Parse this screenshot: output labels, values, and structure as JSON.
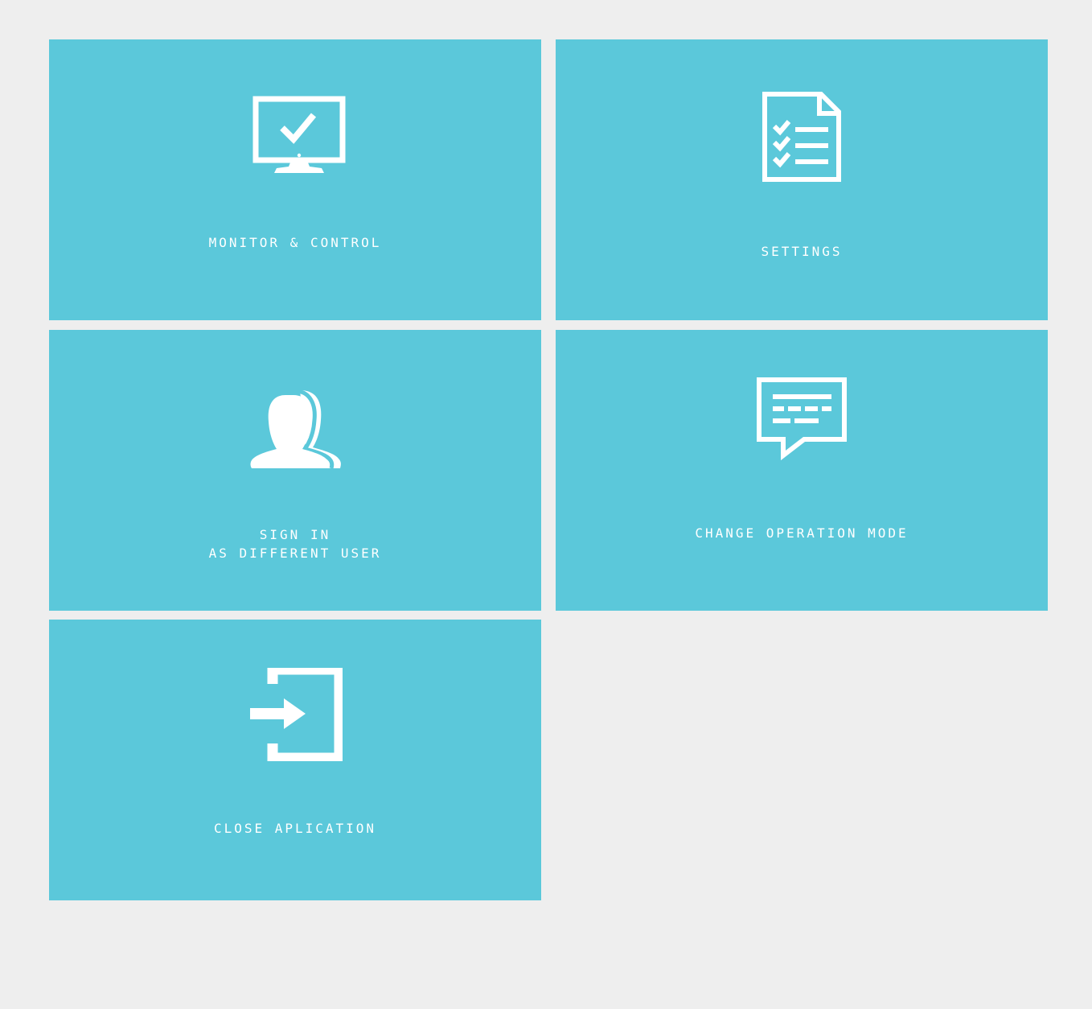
{
  "theme": {
    "background": "#eeeeee",
    "tile_color": "#5bc8da",
    "text_color": "#ffffff"
  },
  "tiles": {
    "monitor": {
      "label": "MONITOR & CONTROL",
      "icon": "monitor-check-icon"
    },
    "settings": {
      "label": "SETTINGS",
      "icon": "checklist-document-icon"
    },
    "signin": {
      "label_line1": "SIGN IN",
      "label_line2": "AS DIFFERENT USER",
      "icon": "users-icon"
    },
    "mode": {
      "label": "CHANGE OPERATION MODE",
      "icon": "speech-bubble-icon"
    },
    "close": {
      "label": "CLOSE APLICATION",
      "icon": "sign-in-arrow-icon"
    }
  }
}
